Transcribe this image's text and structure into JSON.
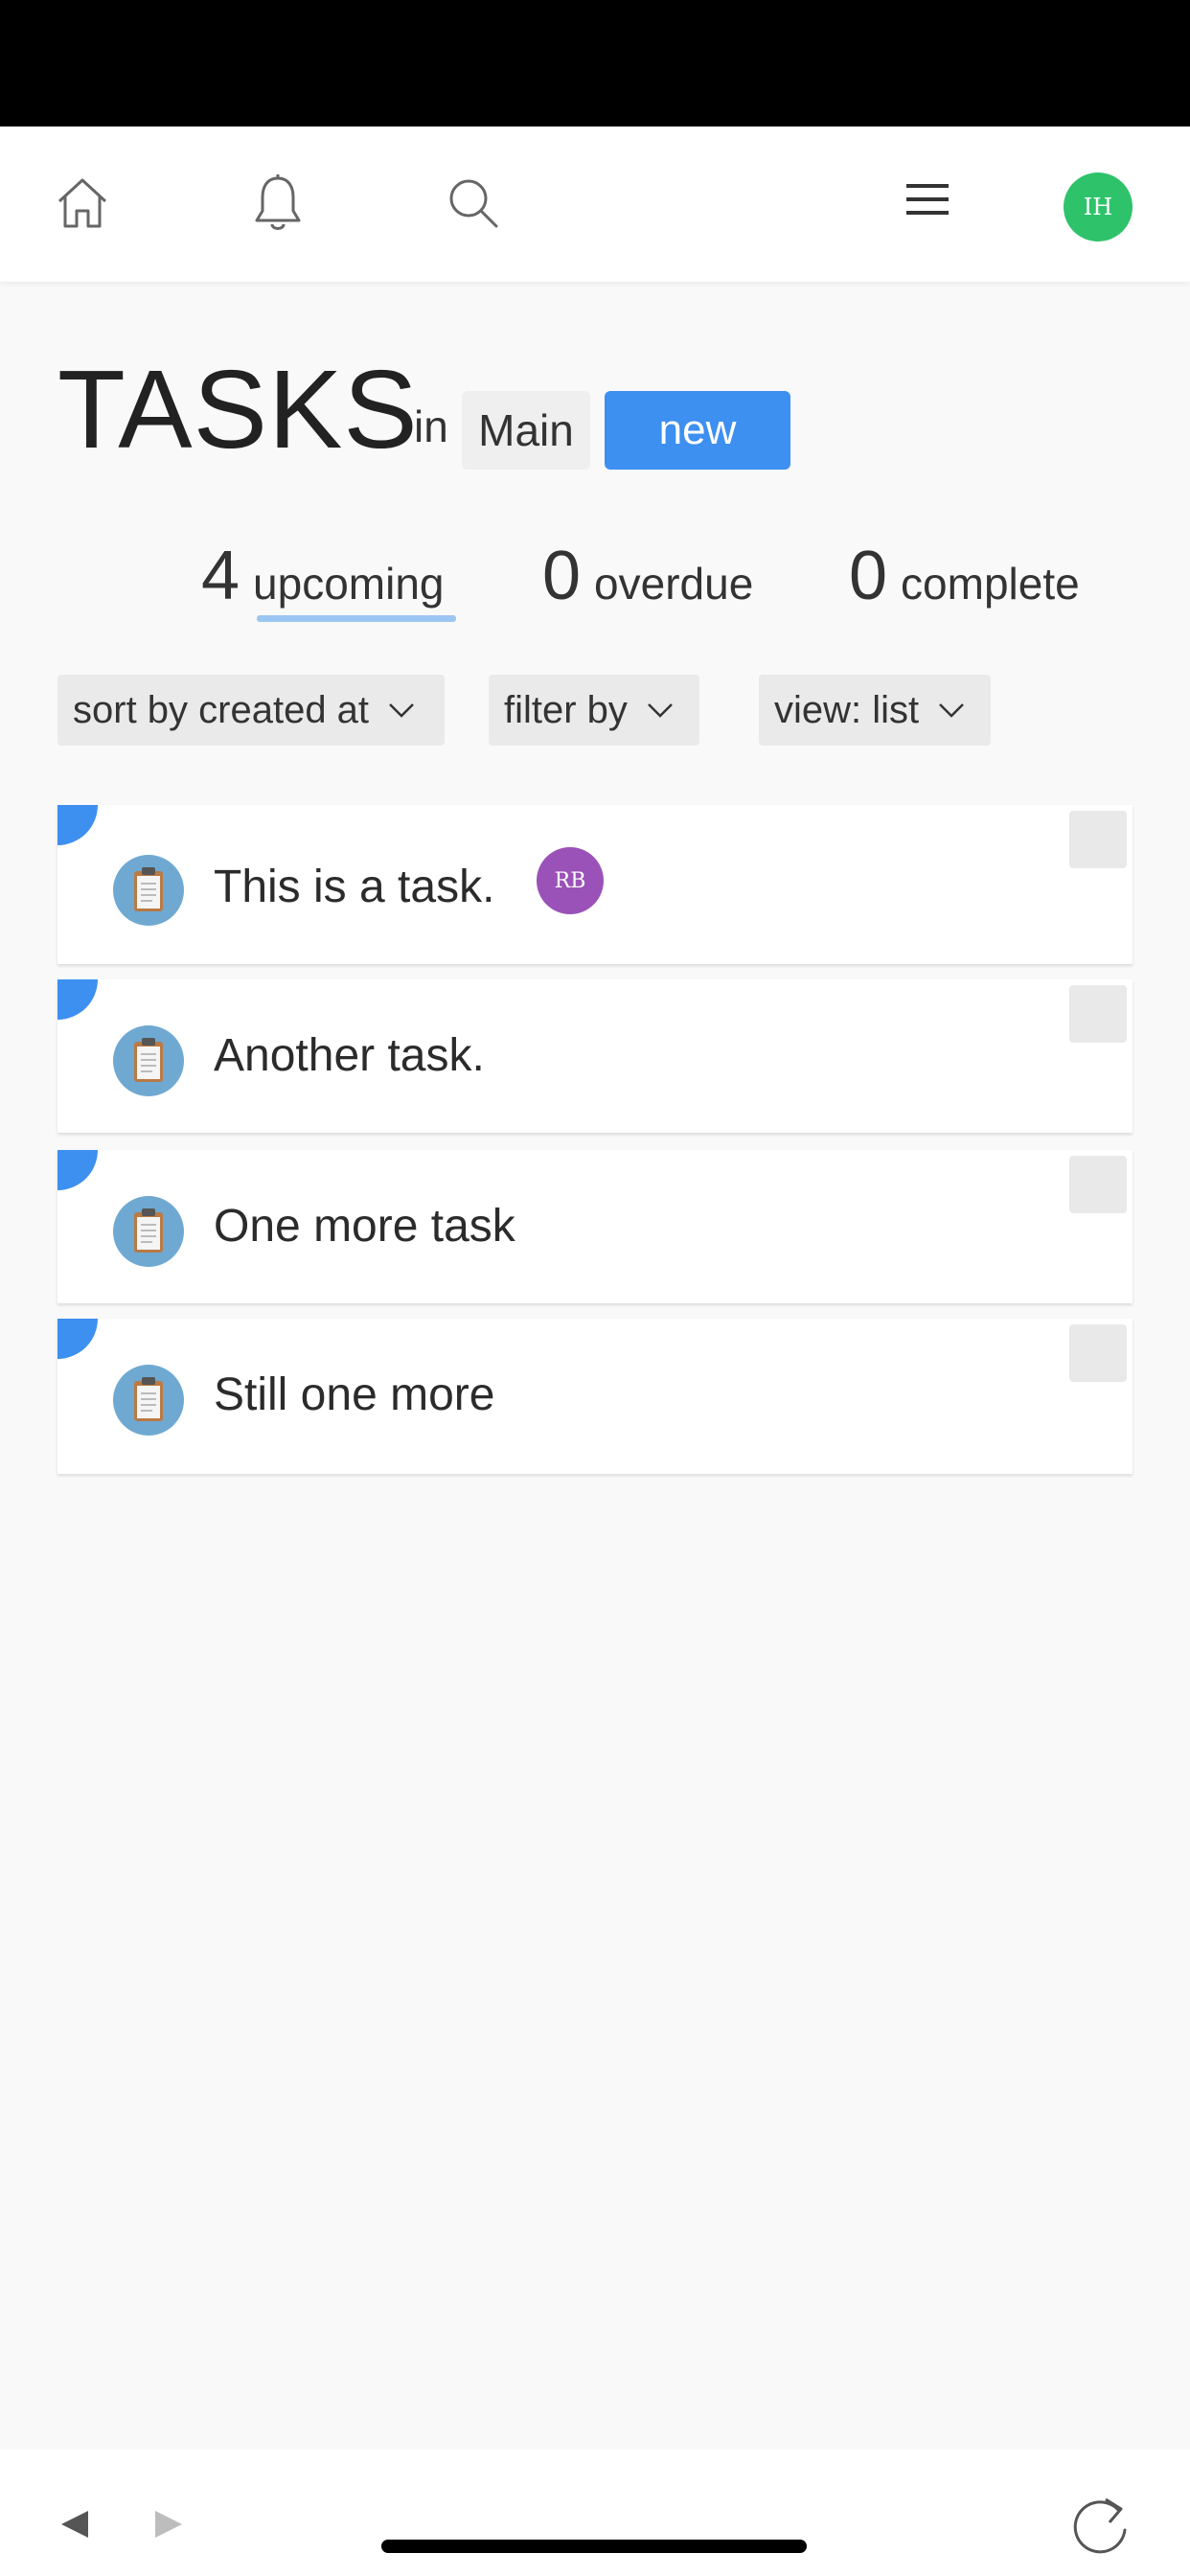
{
  "header": {
    "icons": [
      "home-icon",
      "bell-icon",
      "search-icon",
      "menu-icon"
    ],
    "user_initials": "IH",
    "avatar_color": "#2ec26b"
  },
  "page": {
    "title": "TASKS",
    "in_label": "in",
    "workspace": "Main",
    "new_label": "new",
    "accent_color": "#3d8ff0"
  },
  "stats": [
    {
      "count": "4",
      "label": "upcoming",
      "active": true
    },
    {
      "count": "0",
      "label": "overdue",
      "active": false
    },
    {
      "count": "0",
      "label": "complete",
      "active": false
    }
  ],
  "controls": {
    "sort_label": "sort by created at",
    "filter_label": "filter by",
    "view_label": "view: list"
  },
  "tasks": [
    {
      "title": "This is a task.",
      "assignee": "RB",
      "assignee_color": "#9b52b8",
      "icon": "clipboard-icon"
    },
    {
      "title": "Another task.",
      "icon": "clipboard-icon"
    },
    {
      "title": "One more task",
      "icon": "clipboard-icon"
    },
    {
      "title": "Still one more",
      "icon": "clipboard-icon"
    }
  ],
  "browser_bar": {
    "icons": [
      "back-arrow-icon",
      "forward-arrow-icon",
      "reload-icon"
    ]
  }
}
